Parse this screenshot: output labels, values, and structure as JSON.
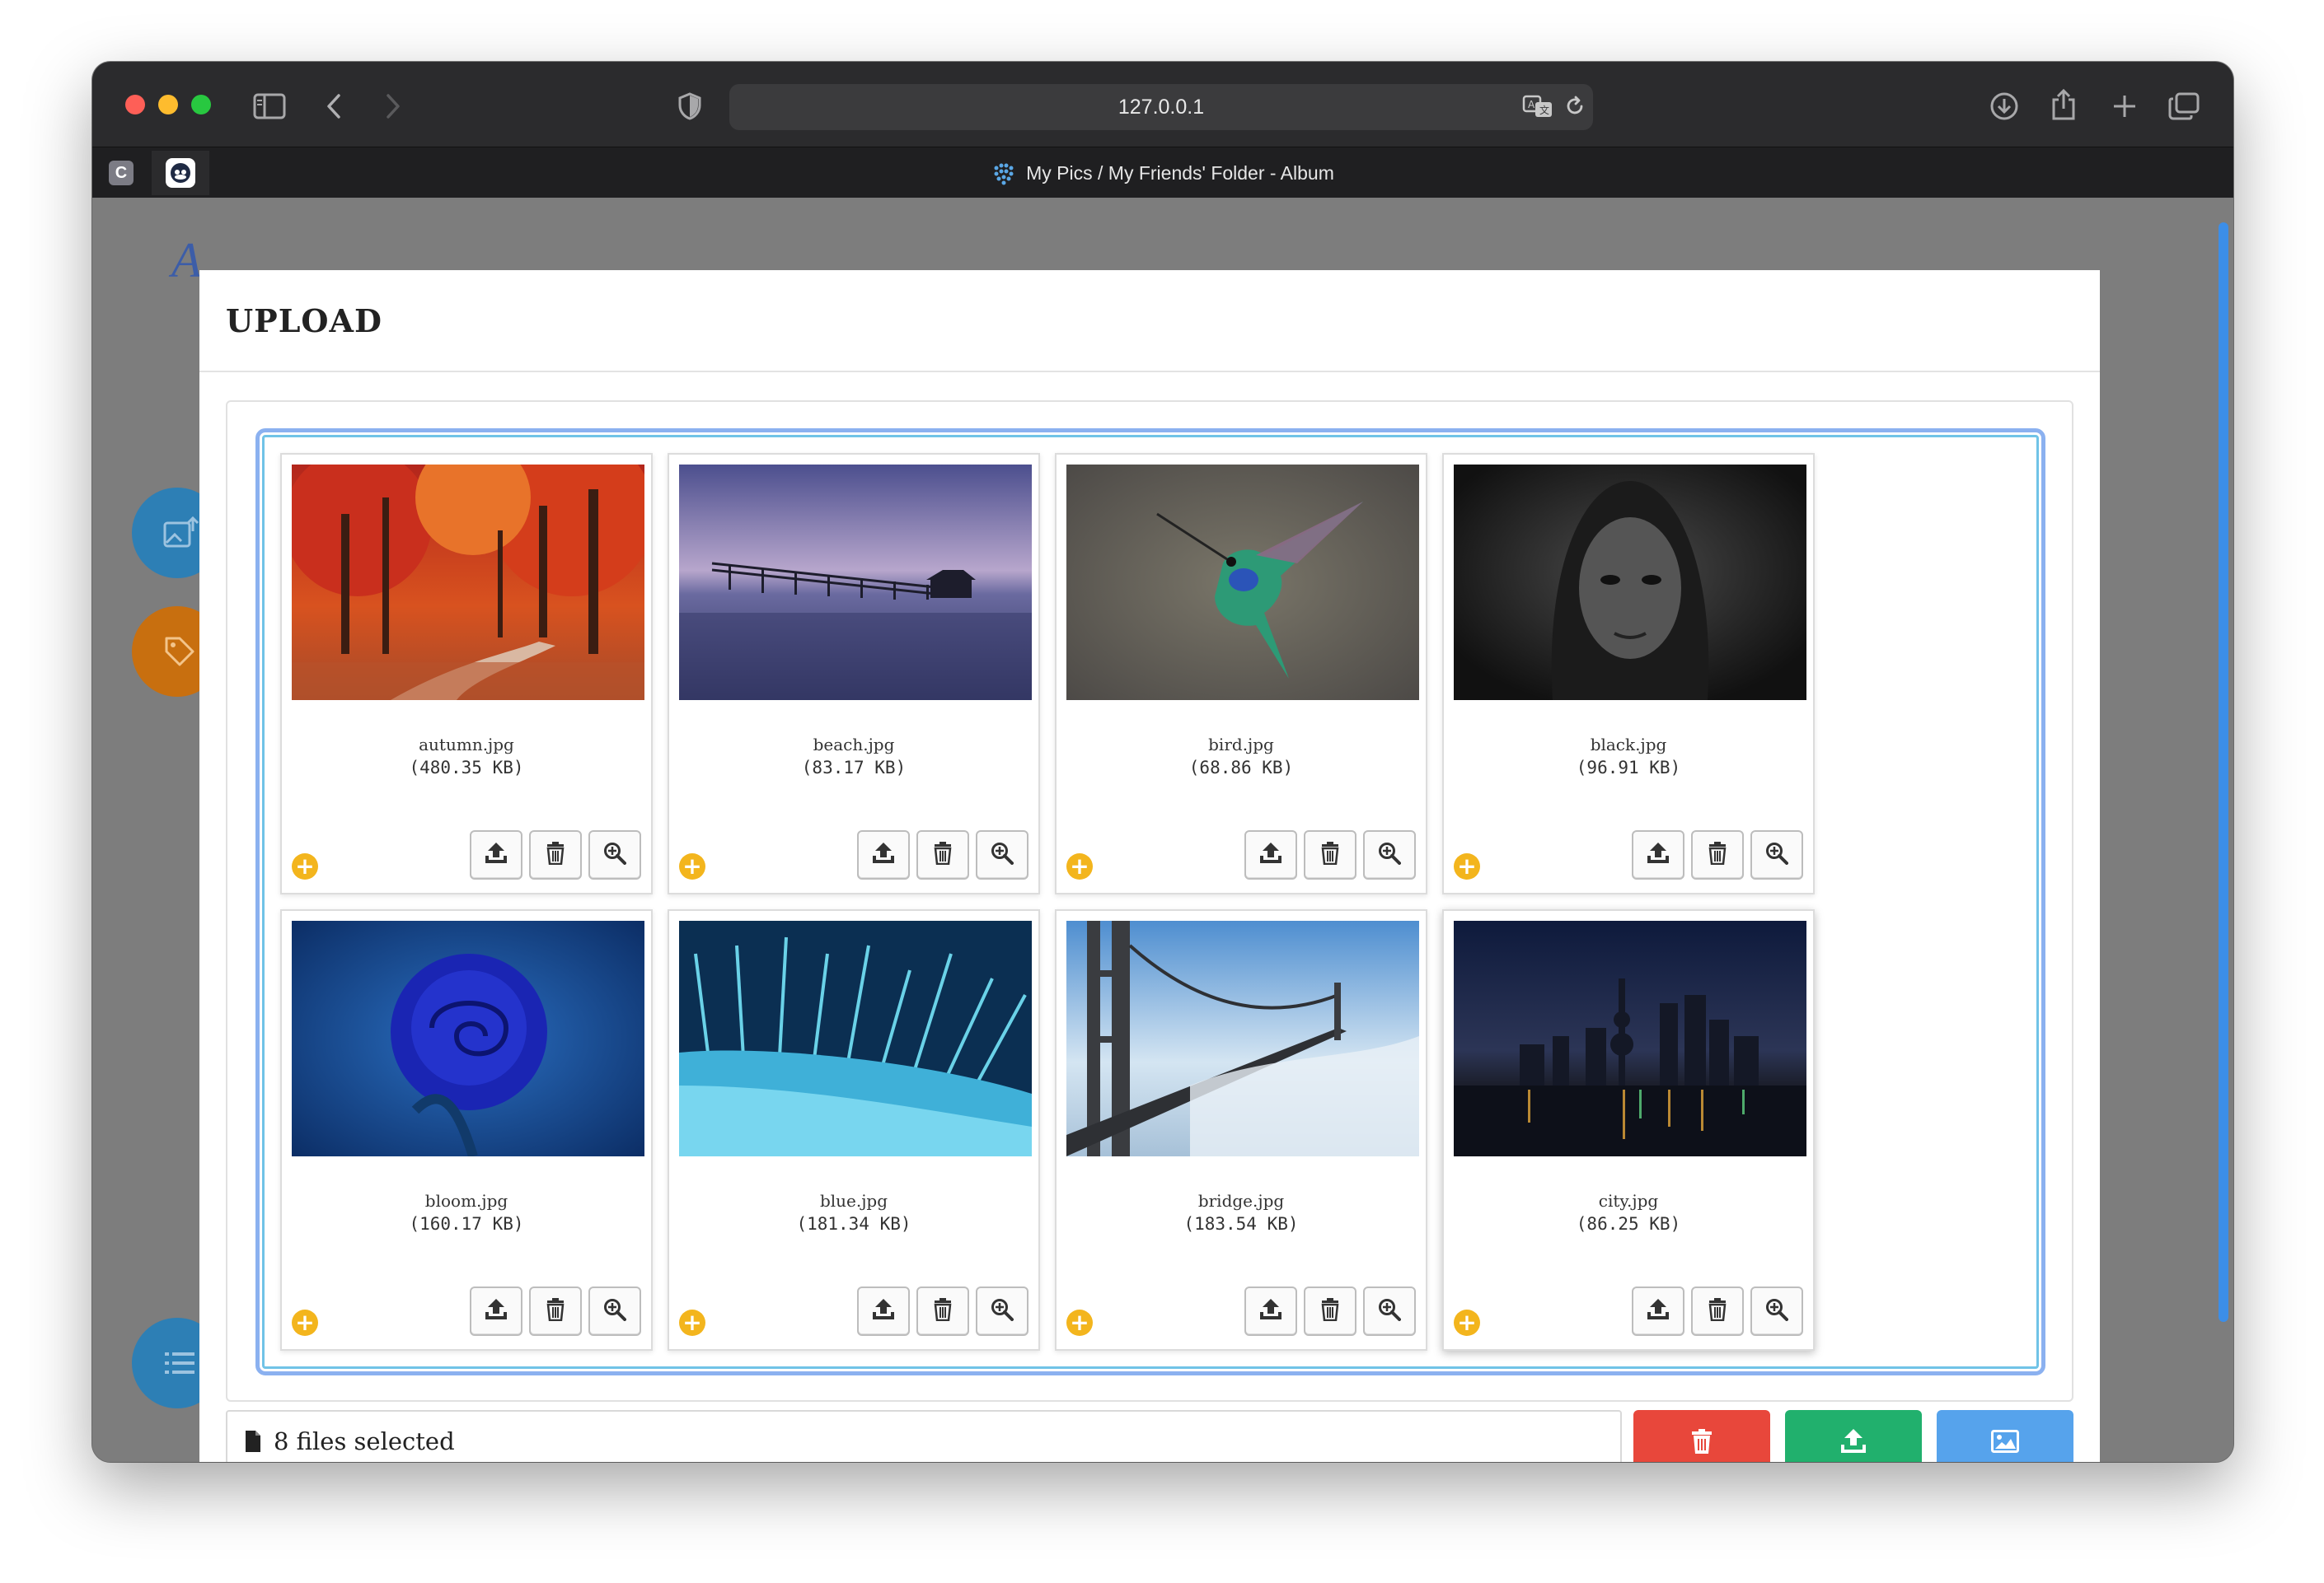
{
  "browser": {
    "url": "127.0.0.1",
    "tab_title": "My Pics / My Friends' Folder - Album",
    "pinned_tabs": [
      {
        "label": "C",
        "icon": "c-app-icon"
      },
      {
        "label": "",
        "icon": "cloud-app-icon"
      }
    ]
  },
  "page": {
    "logo_letter": "A"
  },
  "modal": {
    "title": "UPLOAD",
    "files_selected": "8 files selected",
    "files": [
      {
        "name": "autumn.jpg",
        "size": "(480.35 KB)",
        "image": "autumn"
      },
      {
        "name": "beach.jpg",
        "size": "(83.17 KB)",
        "image": "beach"
      },
      {
        "name": "bird.jpg",
        "size": "(68.86 KB)",
        "image": "bird"
      },
      {
        "name": "black.jpg",
        "size": "(96.91 KB)",
        "image": "black"
      },
      {
        "name": "bloom.jpg",
        "size": "(160.17 KB)",
        "image": "bloom"
      },
      {
        "name": "blue.jpg",
        "size": "(181.34 KB)",
        "image": "blue"
      },
      {
        "name": "bridge.jpg",
        "size": "(183.54 KB)",
        "image": "bridge"
      },
      {
        "name": "city.jpg",
        "size": "(86.25 KB)",
        "image": "city"
      }
    ]
  },
  "colors": {
    "delete": "#e8473b",
    "upload": "#21b06d",
    "browse": "#56a3ec",
    "add_badge": "#f3b51d"
  }
}
